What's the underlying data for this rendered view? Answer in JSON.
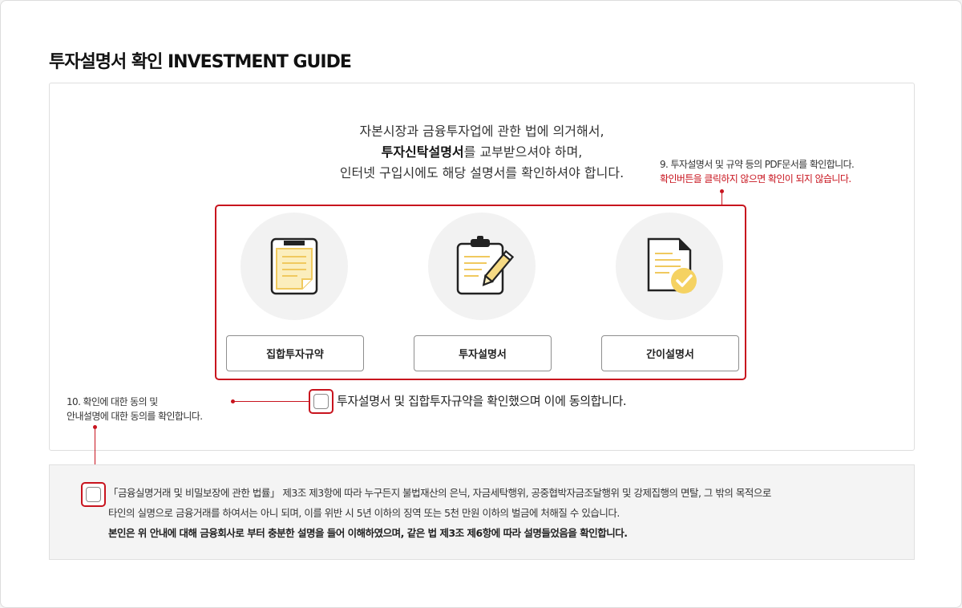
{
  "page_title": "투자설명서 확인 INVESTMENT GUIDE",
  "intro": {
    "line1": "자본시장과 금융투자업에 관한 법에 의거해서,",
    "line2_bold": "투자신탁설명서",
    "line2_rest": "를 교부받으셔야 하며,",
    "line3": "인터넷 구입시에도 해당 설명서를 확인하셔야 합니다."
  },
  "documents": [
    {
      "label": "집합투자규약",
      "icon": "document-icon"
    },
    {
      "label": "투자설명서",
      "icon": "clipboard-pen-icon"
    },
    {
      "label": "간이설명서",
      "icon": "document-check-icon"
    }
  ],
  "note9": {
    "line1": "9. 투자설명서 및 규약 등의 PDF문서를 확인합니다.",
    "line2": "확인버튼을 클릭하지 않으면 확인이 되지 않습니다."
  },
  "note10": {
    "line1": "10. 확인에 대한 동의 및",
    "line2": "안내설명에 대한 동의를 확인합니다."
  },
  "agree_label": "투자설명서 및 집합투자규약을 확인했으며 이에 동의합니다.",
  "legal": {
    "line1": "「금융실명거래 및 비밀보장에 관한 법률」 제3조 제3항에 따라 누구든지 불법재산의 은닉, 자금세탁행위, 공중협박자금조달행위 및 강제집행의 면탈, 그 밖의 목적으로",
    "line2": "타인의 실명으로 금융거래를 하여서는 아니 되며, 이를 위반 시 5년 이하의 징역 또는 5천 만원 이하의 벌금에 처해질 수 있습니다.",
    "line3": "본인은 위 안내에 대해 금융회사로 부터 충분한 설명을 들어 이해하였으며, 같은 법 제3조 제6항에 따라 설명들었음을 확인합니다."
  },
  "colors": {
    "accent_red": "#c8141e",
    "icon_yellow": "#f5d983",
    "icon_outline": "#222222",
    "circle_bg": "#f2f2f2"
  }
}
